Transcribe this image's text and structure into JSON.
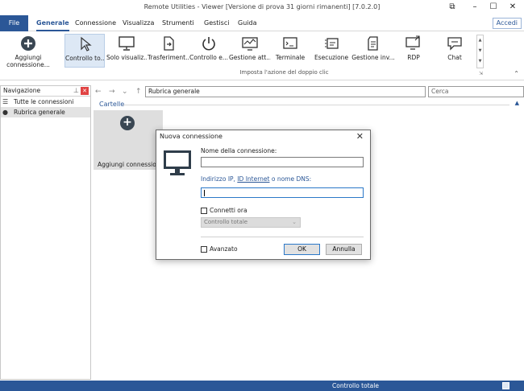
{
  "window": {
    "title": "Remote Utilities - Viewer [Versione di prova 31 giorni rimanenti] [7.0.2.0]",
    "controls": {
      "restore": "⧉",
      "minimize": "–",
      "maximize": "☐",
      "close": "✕"
    }
  },
  "menubar": {
    "file": "File",
    "tabs": [
      "Generale",
      "Connessione",
      "Visualizza",
      "Strumenti",
      "Gestisci",
      "Guida"
    ],
    "sign_in": "Accedi"
  },
  "ribbon": {
    "add_connection": "Aggiungi\nconnessione...",
    "modes": [
      {
        "label": "Controllo to...",
        "icon": "cursor-icon"
      },
      {
        "label": "Solo visualiz...",
        "icon": "monitor-icon"
      },
      {
        "label": "Trasferiment...",
        "icon": "file-transfer-icon"
      },
      {
        "label": "Controllo e...",
        "icon": "power-icon"
      },
      {
        "label": "Gestione att...",
        "icon": "task-manager-icon"
      },
      {
        "label": "Terminale",
        "icon": "terminal-icon"
      },
      {
        "label": "Esecuzione",
        "icon": "execute-icon"
      },
      {
        "label": "Gestione inv...",
        "icon": "inventory-icon"
      },
      {
        "label": "RDP",
        "icon": "rdp-icon"
      },
      {
        "label": "Chat",
        "icon": "chat-icon"
      }
    ],
    "group_label": "Imposta l'azione del doppio clic"
  },
  "navigation": {
    "header": "Navigazione",
    "items": [
      {
        "label": "Tutte le connessioni",
        "icon": "list-icon"
      },
      {
        "label": "Rubrica generale",
        "icon": "address-book-icon"
      }
    ]
  },
  "address": {
    "path": "Rubrica generale",
    "search_placeholder": "Cerca"
  },
  "content": {
    "section_title": "Cartelle",
    "tile_label": "Aggiungi connessione..."
  },
  "dialog": {
    "title": "Nuova connessione",
    "name_label": "Nome della connessione:",
    "name_value": "",
    "address_label_pre": "Indirizzo IP, ",
    "address_label_link": "ID Internet",
    "address_label_post": " o nome DNS:",
    "address_value": "",
    "connect_now_label": "Connetti ora",
    "connect_now_checked": false,
    "mode_selected": "Controllo totale",
    "advanced_label": "Avanzato",
    "advanced_checked": false,
    "ok_label": "OK",
    "cancel_label": "Annulla"
  },
  "statusbar": {
    "mode": "Controllo totale"
  },
  "colors": {
    "accent": "#2b5797",
    "status_bar": "#2b5797",
    "selected_ribbon": "#dde8f5"
  }
}
